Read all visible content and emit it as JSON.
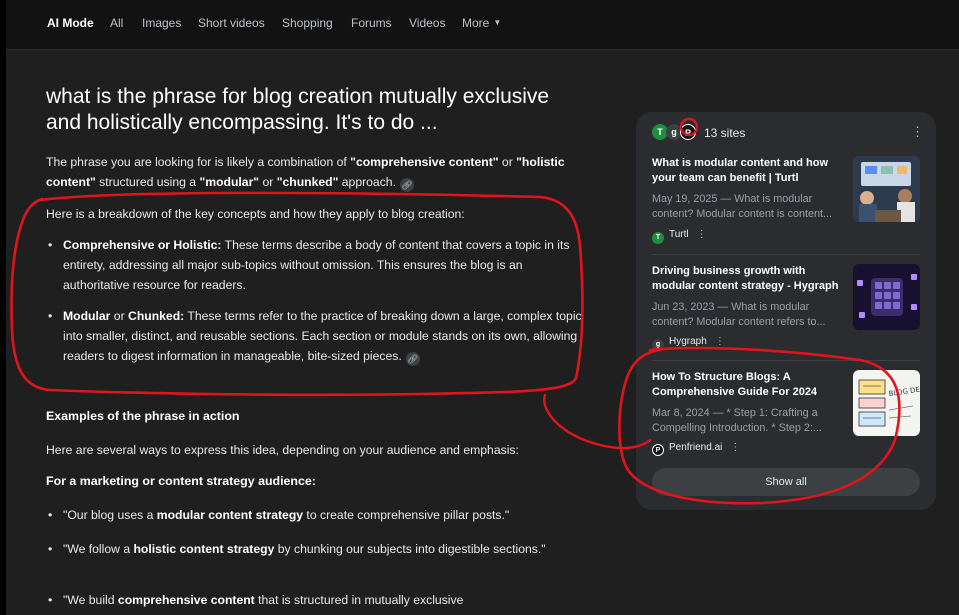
{
  "tabs": {
    "ai_mode": "AI Mode",
    "all": "All",
    "images": "Images",
    "short_videos": "Short videos",
    "shopping": "Shopping",
    "forums": "Forums",
    "videos": "Videos",
    "more": "More"
  },
  "answer": {
    "question": "what is the phrase for blog creation mutually exclusive and holistically encompassing. It's to do ...",
    "intro": {
      "p1": "The phrase you are looking for is likely a combination of ",
      "b1": "\"comprehensive content\"",
      "p2": " or ",
      "b2": "\"holistic content\"",
      "p3": " structured using a ",
      "b3": "\"modular\"",
      "p4": " or ",
      "b4": "\"chunked\"",
      "p5": " approach."
    },
    "breakdown": "Here is a breakdown of the key concepts and how they apply to blog creation:",
    "bullet1": {
      "bold": "Comprehensive or Holistic:",
      "text": " These terms describe a body of content that covers a topic in its entirety, addressing all major sub-topics without omission. This ensures the blog is an authoritative resource for readers."
    },
    "bullet2": {
      "bold1": "Modular",
      "mid": " or ",
      "bold2": "Chunked:",
      "text": " These terms refer to the practice of breaking down a large, complex topic into smaller, distinct, and reusable sections. Each section or module stands on its own, allowing readers to digest information in manageable, bite-sized pieces."
    },
    "examples_heading": "Examples of the phrase in action",
    "examples_intro": "Here are several ways to express this idea, depending on your audience and emphasis:",
    "marketing_heading": "For a marketing or content strategy audience:",
    "ex1": {
      "a": "\"Our blog uses a ",
      "b": "modular content strategy",
      "c": " to create comprehensive pillar posts.\""
    },
    "ex2": {
      "a": "\"We follow a ",
      "b": "holistic content strategy",
      "c": " by chunking our subjects into digestible sections.\""
    },
    "ex3": {
      "a": "\"We build ",
      "b": "comprehensive content",
      "c": " that is structured in mutually exclusive"
    }
  },
  "sources": {
    "count_label": "13 sites",
    "favicons": [
      "T",
      "g",
      "P"
    ],
    "cards": [
      {
        "title": "What is modular content and how your team can benefit | Turtl",
        "snippet": "May 19, 2025 — What is modular content? Modular content is content...",
        "source": "Turtl",
        "favicon": "T"
      },
      {
        "title": "Driving business growth with modular content strategy - Hygraph",
        "snippet": "Jun 23, 2023 — What is modular content? Modular content refers to...",
        "source": "Hygraph",
        "favicon": "g"
      },
      {
        "title": "How To Structure Blogs: A Comprehensive Guide For 2024",
        "snippet": "Mar 8, 2024 — * Step 1: Crafting a Compelling Introduction. * Step 2:...",
        "source": "Penfriend.ai",
        "favicon": "P"
      }
    ],
    "show_all": "Show all",
    "thumb3_text": "BLOG DESIGN"
  },
  "colors": {
    "page_bg": "#1f1f1f",
    "panel_bg": "#2b2c2f",
    "annotation_red": "#e0151b",
    "turtl_green": "#1e8e3e",
    "hygraph_purple": "#7c3aed"
  },
  "icons": {
    "link": "link-icon",
    "more": "more-vert-icon",
    "caret": "caret-down-icon"
  }
}
